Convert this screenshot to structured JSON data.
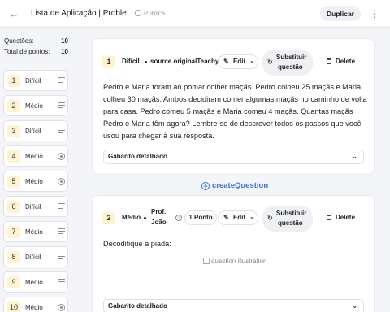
{
  "header": {
    "title": "Lista de Aplicação | Proble...",
    "visibility": "Pública",
    "duplicate_label": "Duplicar"
  },
  "sidebar": {
    "questions_label": "Questões:",
    "questions_value": "10",
    "points_label": "Total de pontos:",
    "points_value": "10",
    "items": [
      {
        "number": "1",
        "difficulty": "Difícil",
        "type": "text"
      },
      {
        "number": "2",
        "difficulty": "Médio",
        "type": "text"
      },
      {
        "number": "3",
        "difficulty": "Difícil",
        "type": "text"
      },
      {
        "number": "4",
        "difficulty": "Médio",
        "type": "choice"
      },
      {
        "number": "5",
        "difficulty": "Médio",
        "type": "choice"
      },
      {
        "number": "6",
        "difficulty": "Difícil",
        "type": "text"
      },
      {
        "number": "7",
        "difficulty": "Médio",
        "type": "text"
      },
      {
        "number": "8",
        "difficulty": "Difícil",
        "type": "text"
      },
      {
        "number": "9",
        "difficulty": "Médio",
        "type": "text"
      },
      {
        "number": "10",
        "difficulty": "Médio",
        "type": "choice"
      }
    ]
  },
  "questions": [
    {
      "number": "1",
      "difficulty": "Difícil",
      "source": "source.originalTeachy",
      "edit_label": "Edit",
      "substitute_line1": "Substituir",
      "substitute_line2": "questão",
      "delete_label": "Delete",
      "text": "Pedro e Maria foram ao pomar colher maçãs. Pedro colheu 25 maçãs e Maria colheu 30 maçãs. Ambos decidiram comer algumas maçãs no caminho de volta para casa. Pedro comeu 5 maçãs e Maria comeu 4 maçãs. Quantas maçãs Pedro e Maria têm agora? Lembre-se de descrever todos os passos que você usou para chegar à sua resposta.",
      "answer_label": "Gabarito detalhado"
    },
    {
      "number": "2",
      "difficulty": "Médio",
      "author_line1": "Prof.",
      "author_line2": "João",
      "points_label": "1 Ponto",
      "edit_label": "Edit",
      "substitute_line1": "Substituir",
      "substitute_line2": "questão",
      "delete_label": "Delete",
      "text": "Decodifique a piada:",
      "image_alt": "question illustration",
      "answer_label": "Gabarito detalhado"
    }
  ],
  "create_label": "createQuestion",
  "colors": {
    "accent": "#3b6fd8",
    "badge_bg": "#fff3d1",
    "page_bg": "#f3f5f8"
  }
}
